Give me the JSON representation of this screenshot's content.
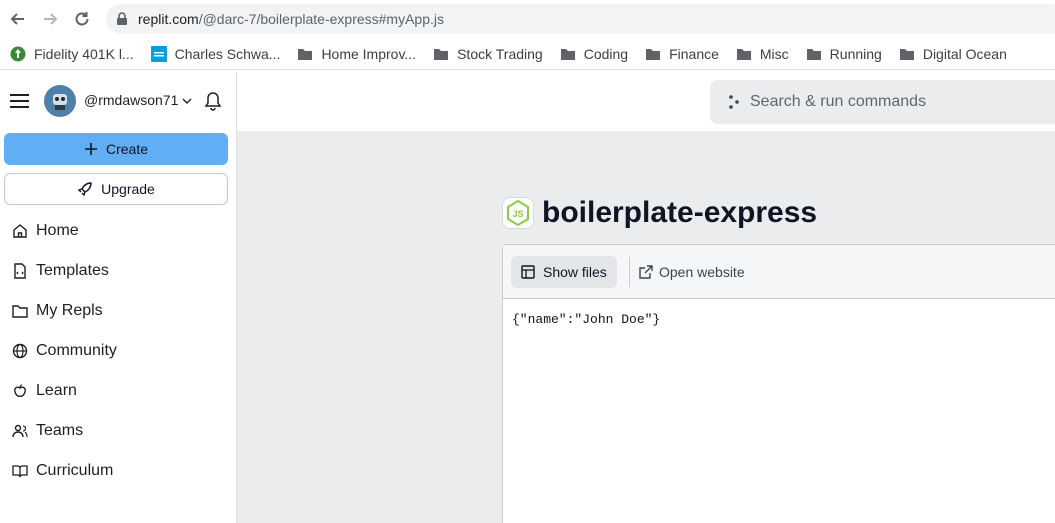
{
  "browser": {
    "url_host": "replit.com",
    "url_path": "/@darc-7/boilerplate-express#myApp.js",
    "bookmarks": [
      {
        "label": "Fidelity 401K l...",
        "icon": "fidelity-icon"
      },
      {
        "label": "Charles Schwa...",
        "icon": "schwab-icon"
      },
      {
        "label": "Home Improv...",
        "icon": "folder-icon"
      },
      {
        "label": "Stock Trading",
        "icon": "folder-icon"
      },
      {
        "label": "Coding",
        "icon": "folder-icon"
      },
      {
        "label": "Finance",
        "icon": "folder-icon"
      },
      {
        "label": "Misc",
        "icon": "folder-icon"
      },
      {
        "label": "Running",
        "icon": "folder-icon"
      },
      {
        "label": "Digital Ocean",
        "icon": "folder-icon"
      }
    ]
  },
  "sidebar": {
    "username": "@rmdawson71",
    "create_label": "Create",
    "upgrade_label": "Upgrade",
    "items": [
      {
        "label": "Home",
        "icon": "home-icon"
      },
      {
        "label": "Templates",
        "icon": "templates-icon"
      },
      {
        "label": "My Repls",
        "icon": "folder-icon"
      },
      {
        "label": "Community",
        "icon": "globe-icon"
      },
      {
        "label": "Learn",
        "icon": "learn-icon"
      },
      {
        "label": "Teams",
        "icon": "teams-icon"
      },
      {
        "label": "Curriculum",
        "icon": "book-icon"
      }
    ]
  },
  "topbar": {
    "search_placeholder": "Search & run commands"
  },
  "repl": {
    "title": "boilerplate-express",
    "logo_text": "JS",
    "show_files_label": "Show files",
    "open_website_label": "Open website",
    "output": "{\"name\":\"John Doe\"}"
  },
  "colors": {
    "accent": "#62aef5",
    "node_green": "#8cc84b"
  }
}
